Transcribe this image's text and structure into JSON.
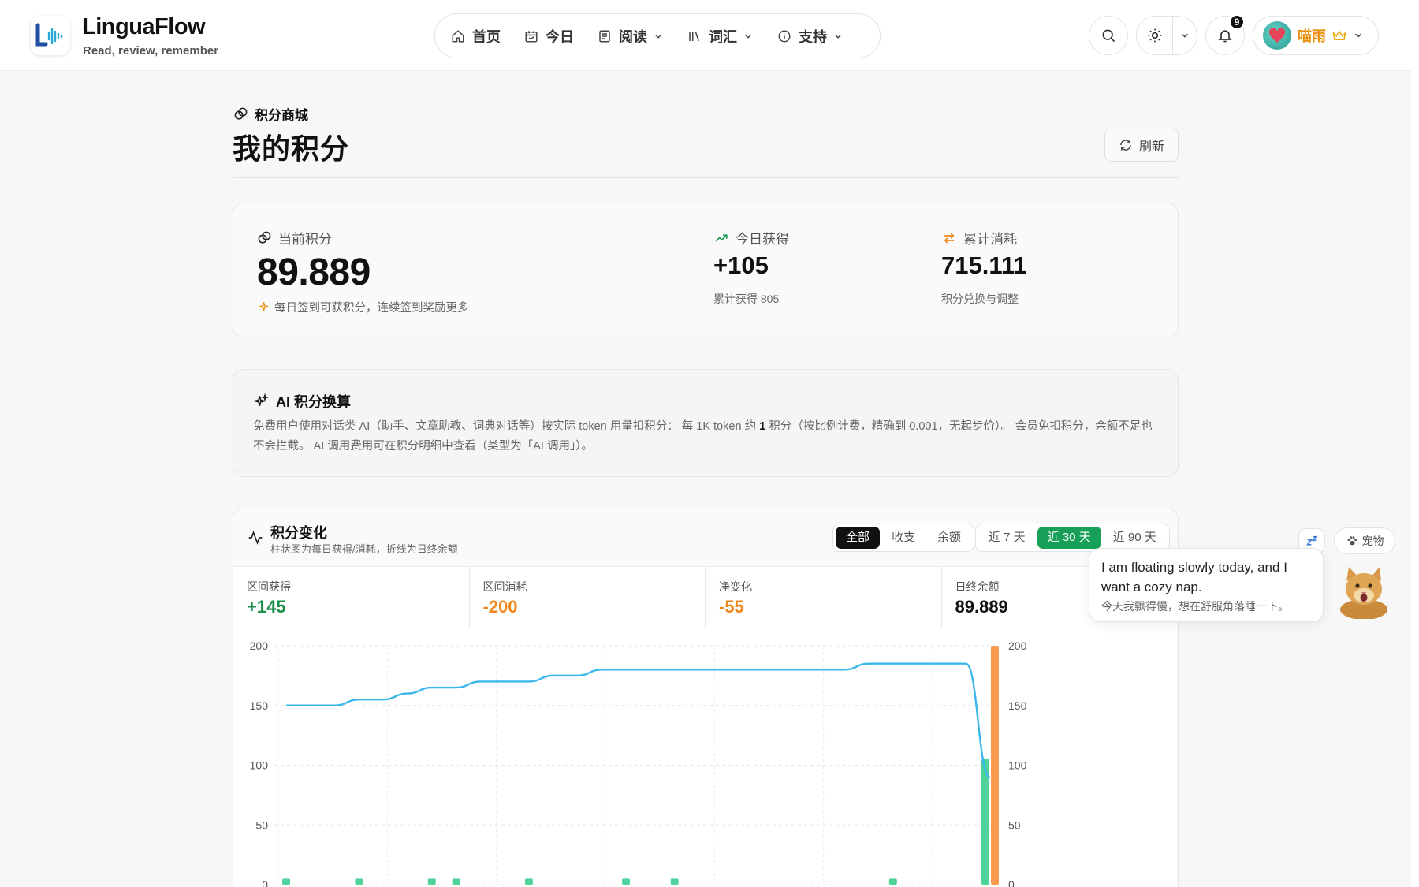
{
  "header": {
    "app_name": "LinguaFlow",
    "tagline": "Read, review, remember",
    "nav": [
      {
        "label": "首页",
        "icon": "home-icon"
      },
      {
        "label": "今日",
        "icon": "calendar-icon"
      },
      {
        "label": "阅读",
        "icon": "book-icon",
        "dropdown": true
      },
      {
        "label": "词汇",
        "icon": "library-icon",
        "dropdown": true
      },
      {
        "label": "支持",
        "icon": "info-icon",
        "dropdown": true
      }
    ],
    "notifications": "9",
    "user_name": "喵雨"
  },
  "page": {
    "crumb": "积分商城",
    "title": "我的积分",
    "refresh_label": "刷新"
  },
  "summary": {
    "current_label": "当前积分",
    "current_value": "89.889",
    "current_hint": "每日签到可获积分，连续签到奖励更多",
    "today_label": "今日获得",
    "today_value": "+105",
    "today_sub": "累计获得 805",
    "spent_label": "累计消耗",
    "spent_value": "715.111",
    "spent_sub": "积分兑换与调整"
  },
  "ai": {
    "title": "AI 积分换算",
    "body_a": "免费用户使用对话类 AI（助手、文章助教、词典对话等）按实际 token 用量扣积分： 每 1K token 约 ",
    "body_b": "1",
    "body_c": " 积分（按比例计费，精确到 0.001，无起步价）。 会员免扣积分，余额不足也不会拦截。 AI 调用费用可在积分明细中查看（类型为「AI 调用」）。"
  },
  "chart_card": {
    "title": "积分变化",
    "subtitle": "柱状图为每日获得/消耗，折线为日终余额",
    "mode_tabs": [
      "全部",
      "收支",
      "余额"
    ],
    "range_tabs": [
      "近 7 天",
      "近 30 天",
      "近 90 天"
    ],
    "metrics": [
      {
        "label": "区间获得",
        "value": "+145",
        "color": "#1a8f4a"
      },
      {
        "label": "区间消耗",
        "value": "-200",
        "color": "#f0871a"
      },
      {
        "label": "净变化",
        "value": "-55",
        "color": "#f0871a"
      },
      {
        "label": "日终余额",
        "value": "89.889",
        "color": "#111111"
      }
    ]
  },
  "chart_data": {
    "type": "bar",
    "yticks_left": [
      "200",
      "150",
      "100",
      "50",
      "0"
    ],
    "yticks_right": [
      "200",
      "150",
      "100",
      "50",
      "0"
    ],
    "ylim": [
      0,
      200
    ],
    "days": 30,
    "earned": [
      5,
      0,
      0,
      5,
      0,
      0,
      5,
      5,
      0,
      0,
      5,
      0,
      0,
      0,
      5,
      0,
      5,
      0,
      0,
      0,
      0,
      0,
      0,
      0,
      0,
      5,
      0,
      0,
      0,
      105
    ],
    "spent": [
      0,
      0,
      0,
      0,
      0,
      0,
      0,
      0,
      0,
      0,
      0,
      0,
      0,
      0,
      0,
      0,
      0,
      0,
      0,
      0,
      0,
      0,
      0,
      0,
      0,
      0,
      0,
      0,
      0,
      200
    ],
    "balance": [
      150,
      150,
      150,
      155,
      155,
      160,
      165,
      165,
      170,
      170,
      170,
      175,
      175,
      180,
      180,
      180,
      180,
      180,
      180,
      180,
      180,
      180,
      180,
      180,
      185,
      185,
      185,
      185,
      185,
      89.889
    ],
    "colors": {
      "earned": "#4fd39b",
      "spent": "#f99a4f",
      "balance": "#3ab7ea"
    }
  },
  "pet": {
    "pet_label": "宠物",
    "bubble_en": "I am floating slowly today, and I want a cozy nap.",
    "bubble_zh": "今天我飘得慢，想在舒服角落睡一下。"
  }
}
